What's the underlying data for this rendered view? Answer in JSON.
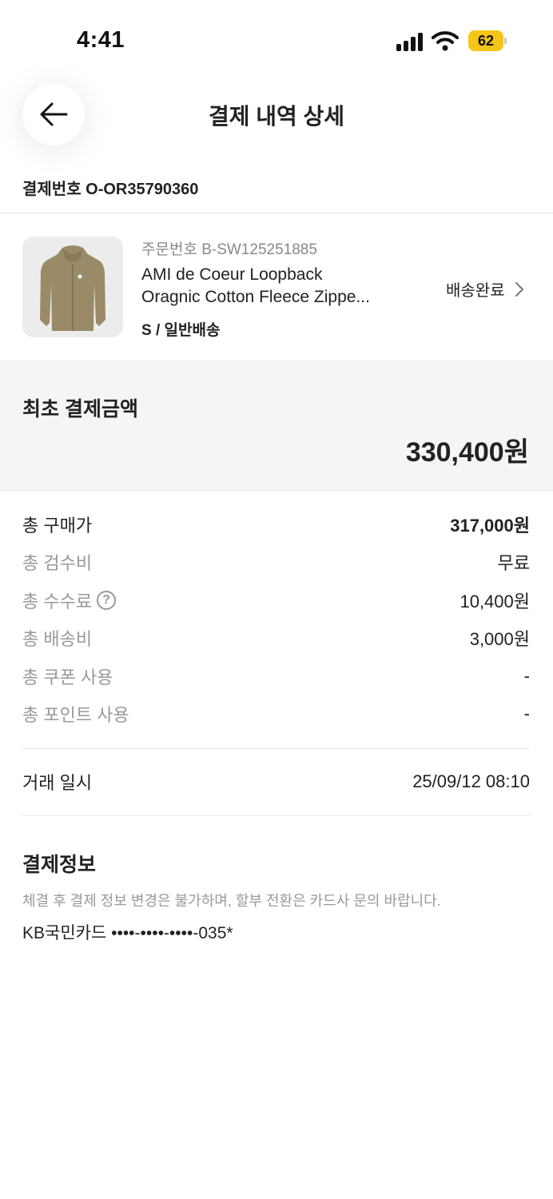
{
  "status_bar": {
    "time": "4:41",
    "battery": "62"
  },
  "header": {
    "title": "결제 내역 상세"
  },
  "payment_number": "결제번호 O-OR35790360",
  "product": {
    "order_number": "주문번호 B-SW125251885",
    "name_line1": "AMI de Coeur Loopback",
    "name_line2": "Oragnic Cotton Fleece Zippe...",
    "option": "S / 일반배송",
    "status": "배송완료"
  },
  "initial_payment": {
    "label": "최초 결제금액",
    "amount": "330,400원"
  },
  "breakdown": [
    {
      "label": "총 구매가",
      "value": "317,000원"
    },
    {
      "label": "총 검수비",
      "value": "무료"
    },
    {
      "label": "총 수수료",
      "value": "10,400원"
    },
    {
      "label": "총 배송비",
      "value": "3,000원"
    },
    {
      "label": "총 쿠폰 사용",
      "value": "-"
    },
    {
      "label": "총 포인트 사용",
      "value": "-"
    }
  ],
  "transaction": {
    "label": "거래 일시",
    "value": "25/09/12 08:10"
  },
  "payment_info": {
    "title": "결제정보",
    "note": "체결 후 결제 정보 변경은 불가하며, 할부 전환은 카드사 문의 바랍니다.",
    "card": "KB국민카드 ••••-••••-••••-035*"
  },
  "colors": {
    "battery": "#f5c518",
    "muted_text": "#999999",
    "panel_bg": "#f5f5f5"
  },
  "icons": [
    "back-arrow-icon",
    "chevron-right-icon",
    "help-icon",
    "signal-icon",
    "wifi-icon",
    "battery-icon"
  ]
}
